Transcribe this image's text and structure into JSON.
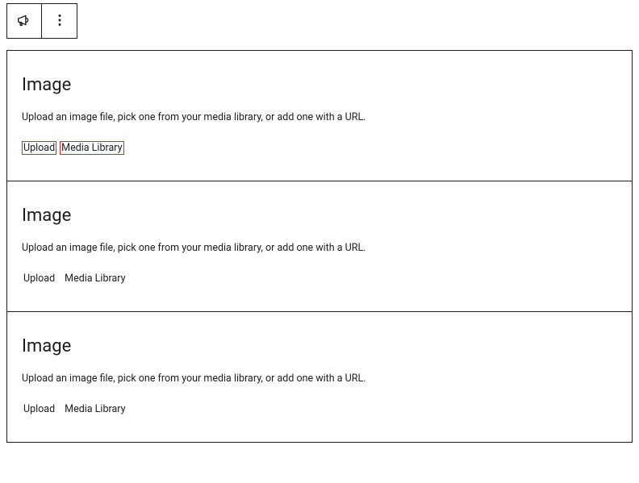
{
  "toolbar": {
    "block_icon": "megaphone",
    "menu_icon": "more-vertical"
  },
  "blocks": [
    {
      "title": "Image",
      "description": "Upload an image file, pick one from your media library, or add one with a URL.",
      "upload_label": "Upload",
      "media_library_label": "Media Library",
      "highlighted": true
    },
    {
      "title": "Image",
      "description": "Upload an image file, pick one from your media library, or add one with a URL.",
      "upload_label": "Upload",
      "media_library_label": "Media Library",
      "highlighted": false
    },
    {
      "title": "Image",
      "description": "Upload an image file, pick one from your media library, or add one with a URL.",
      "upload_label": "Upload",
      "media_library_label": "Media Library",
      "highlighted": false
    }
  ]
}
